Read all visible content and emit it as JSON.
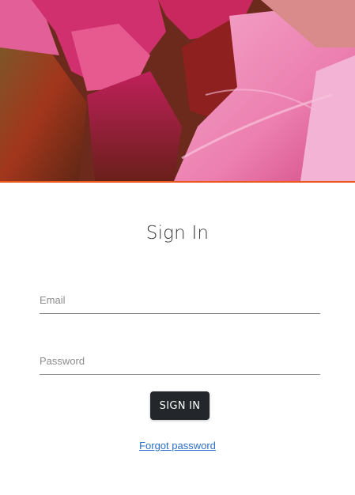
{
  "hero": {
    "image": "pink-flower-petals-photo",
    "accent_color": "#ea5a1f"
  },
  "form": {
    "title": "Sign In",
    "email_placeholder": "Email",
    "email_value": "",
    "password_placeholder": "Password",
    "password_value": "",
    "submit_label": "SIGN IN",
    "forgot_label": "Forgot password"
  },
  "colors": {
    "button_bg": "#23272b",
    "link": "#2a6fc9",
    "underline": "#8a8a8a"
  }
}
